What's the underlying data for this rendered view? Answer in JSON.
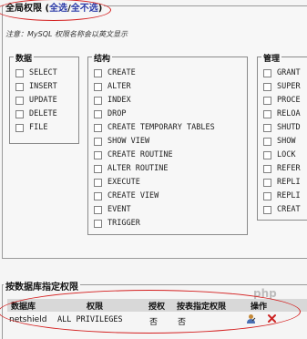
{
  "global": {
    "title": "全局权限",
    "open_paren": "(",
    "select_all": "全选",
    "slash": "/",
    "deselect_all": "全不选",
    "close_paren": ")",
    "note": "注意：MySQL 权限名称会以英文显示"
  },
  "groups": {
    "data": {
      "title": "数据",
      "items": [
        "SELECT",
        "INSERT",
        "UPDATE",
        "DELETE",
        "FILE"
      ]
    },
    "structure": {
      "title": "结构",
      "items": [
        "CREATE",
        "ALTER",
        "INDEX",
        "DROP",
        "CREATE TEMPORARY TABLES",
        "SHOW VIEW",
        "CREATE ROUTINE",
        "ALTER ROUTINE",
        "EXECUTE",
        "CREATE VIEW",
        "EVENT",
        "TRIGGER"
      ]
    },
    "admin": {
      "title": "管理",
      "items": [
        "GRANT",
        "SUPER",
        "PROCE",
        "RELOA",
        "SHUTD",
        "SHOW",
        "LOCK",
        "REFER",
        "REPLI",
        "REPLI",
        "CREAT"
      ]
    }
  },
  "db_privileges": {
    "title": "按数据库指定权限",
    "headers": {
      "database": "数据库",
      "privileges": "权限",
      "grant": "授权",
      "table_specific": "按表指定权限",
      "action": "操作"
    },
    "row": {
      "database": "netshield",
      "privileges": "ALL PRIVILEGES",
      "grant": "否",
      "table_specific": "否"
    }
  },
  "watermark": "php",
  "colors": {
    "link": "#2b3aa8",
    "annotation": "#d42020",
    "header_bg": "#d8d8d8"
  }
}
